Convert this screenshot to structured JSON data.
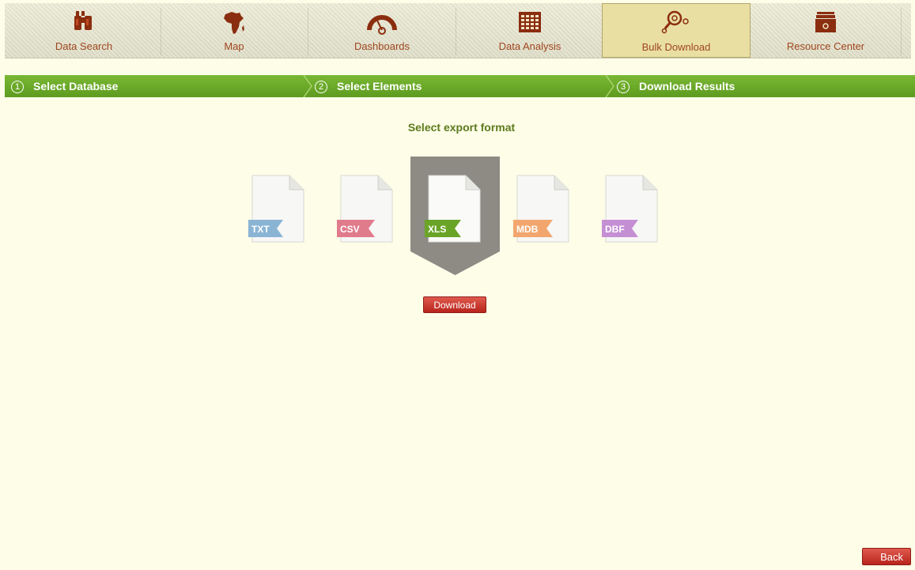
{
  "nav": {
    "items": [
      {
        "label": "Data Search",
        "icon": "binoculars-icon"
      },
      {
        "label": "Map",
        "icon": "africa-map-icon"
      },
      {
        "label": "Dashboards",
        "icon": "gauge-icon"
      },
      {
        "label": "Data Analysis",
        "icon": "grid-table-icon"
      },
      {
        "label": "Bulk Download",
        "icon": "magnify-nodes-icon"
      },
      {
        "label": "Resource Center",
        "icon": "archive-box-icon"
      }
    ],
    "active_index": 4
  },
  "steps": [
    {
      "num": "1",
      "label": "Select Database"
    },
    {
      "num": "2",
      "label": "Select Elements"
    },
    {
      "num": "3",
      "label": "Download Results"
    }
  ],
  "main": {
    "title": "Select export format",
    "formats": [
      {
        "label": "TXT",
        "color": "#8ab4d4"
      },
      {
        "label": "CSV",
        "color": "#e07b8c"
      },
      {
        "label": "XLS",
        "color": "#6aa427"
      },
      {
        "label": "MDB",
        "color": "#f2a66e"
      },
      {
        "label": "DBF",
        "color": "#c58fd4"
      }
    ],
    "selected_format": "XLS",
    "download_label": "Download"
  },
  "footer": {
    "back_label": "Back"
  },
  "colors": {
    "accent_green": "#6aa828",
    "nav_text": "#a0461f",
    "button_red": "#c9342a",
    "title_green": "#5d7a1c",
    "background": "#fdfde8"
  }
}
